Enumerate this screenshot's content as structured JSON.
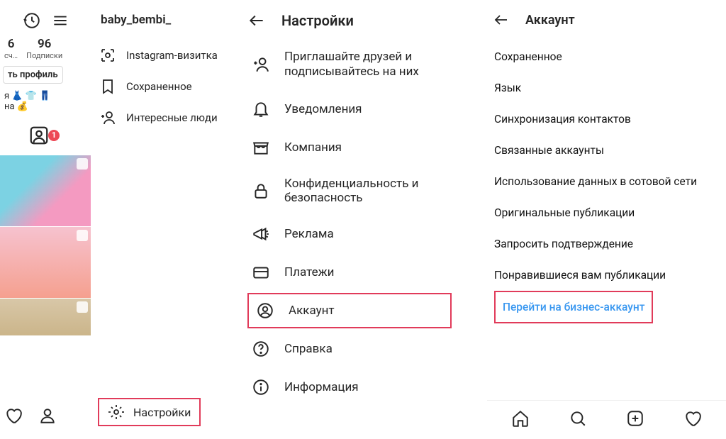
{
  "profile": {
    "handle": "baby_bembi_",
    "stats": [
      {
        "num": "6",
        "label": "сч…"
      },
      {
        "num": "96",
        "label": "Подписки"
      }
    ],
    "edit_label": "ть профиль",
    "bio_line1": "я 👗 👕 👖",
    "bio_line2": "на 💰",
    "hl_badge": "1"
  },
  "side_menu": [
    "Instagram-визитка",
    "Сохраненное",
    "Интересные люди"
  ],
  "side_menu_footer": "Настройки",
  "settings_header": "Настройки",
  "settings_items": [
    "Приглашайте друзей и подписывайтесь на них",
    "Уведомления",
    "Компания",
    "Конфиденциальность и безопасность",
    "Реклама",
    "Платежи",
    "Аккаунт",
    "Справка",
    "Информация"
  ],
  "account_header": "Аккаунт",
  "account_items": [
    "Сохраненное",
    "Язык",
    "Синхронизация контактов",
    "Связанные аккаунты",
    "Использование данных в сотовой сети",
    "Оригинальные публикации",
    "Запросить подтверждение",
    "Понравившиеся вам публикации",
    "Перейти на бизнес-аккаунт"
  ]
}
